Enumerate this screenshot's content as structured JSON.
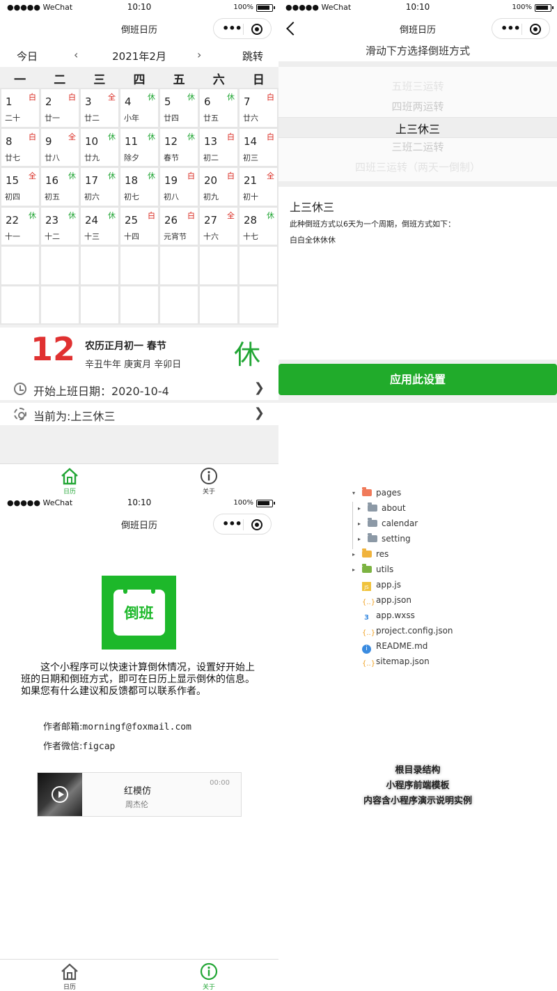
{
  "status_bar": {
    "carrier": "●●●●● WeChat",
    "time": "10:10",
    "battery": "100%"
  },
  "app_title": "倒班日历",
  "calendar": {
    "toolbar": {
      "today": "今日",
      "prev": "‹",
      "month": "2021年2月",
      "next": "›",
      "jump": "跳转"
    },
    "weekdays": [
      "一",
      "二",
      "三",
      "四",
      "五",
      "六",
      "日"
    ],
    "days": [
      {
        "d": "1",
        "lunar": "二十",
        "tag": "白",
        "kind": "work"
      },
      {
        "d": "2",
        "lunar": "廿一",
        "tag": "白",
        "kind": "work"
      },
      {
        "d": "3",
        "lunar": "廿二",
        "tag": "全",
        "kind": "work"
      },
      {
        "d": "4",
        "lunar": "小年",
        "tag": "休",
        "kind": "rest"
      },
      {
        "d": "5",
        "lunar": "廿四",
        "tag": "休",
        "kind": "rest"
      },
      {
        "d": "6",
        "lunar": "廿五",
        "tag": "休",
        "kind": "rest"
      },
      {
        "d": "7",
        "lunar": "廿六",
        "tag": "白",
        "kind": "work"
      },
      {
        "d": "8",
        "lunar": "廿七",
        "tag": "白",
        "kind": "work"
      },
      {
        "d": "9",
        "lunar": "廿八",
        "tag": "全",
        "kind": "work"
      },
      {
        "d": "10",
        "lunar": "廿九",
        "tag": "休",
        "kind": "rest"
      },
      {
        "d": "11",
        "lunar": "除夕",
        "tag": "休",
        "kind": "rest"
      },
      {
        "d": "12",
        "lunar": "春节",
        "tag": "休",
        "kind": "rest"
      },
      {
        "d": "13",
        "lunar": "初二",
        "tag": "白",
        "kind": "work"
      },
      {
        "d": "14",
        "lunar": "初三",
        "tag": "白",
        "kind": "work"
      },
      {
        "d": "15",
        "lunar": "初四",
        "tag": "全",
        "kind": "work"
      },
      {
        "d": "16",
        "lunar": "初五",
        "tag": "休",
        "kind": "rest"
      },
      {
        "d": "17",
        "lunar": "初六",
        "tag": "休",
        "kind": "rest"
      },
      {
        "d": "18",
        "lunar": "初七",
        "tag": "休",
        "kind": "rest"
      },
      {
        "d": "19",
        "lunar": "初八",
        "tag": "白",
        "kind": "work"
      },
      {
        "d": "20",
        "lunar": "初九",
        "tag": "白",
        "kind": "work"
      },
      {
        "d": "21",
        "lunar": "初十",
        "tag": "全",
        "kind": "work"
      },
      {
        "d": "22",
        "lunar": "十一",
        "tag": "休",
        "kind": "rest"
      },
      {
        "d": "23",
        "lunar": "十二",
        "tag": "休",
        "kind": "rest"
      },
      {
        "d": "24",
        "lunar": "十三",
        "tag": "休",
        "kind": "rest"
      },
      {
        "d": "25",
        "lunar": "十四",
        "tag": "白",
        "kind": "work"
      },
      {
        "d": "26",
        "lunar": "元宵节",
        "tag": "白",
        "kind": "work"
      },
      {
        "d": "27",
        "lunar": "十六",
        "tag": "全",
        "kind": "work"
      },
      {
        "d": "28",
        "lunar": "十七",
        "tag": "休",
        "kind": "rest"
      }
    ],
    "empty_cells": 14,
    "detail": {
      "day": "12",
      "lunar_line": "农历正月初一  春节",
      "ganzhi_line": "辛丑牛年  庚寅月  辛卯日",
      "status": "休"
    },
    "start_date_row": "开始上班日期：2020-10-4",
    "mode_row": "当前为:上三休三",
    "chevron": "❯"
  },
  "tabbar": {
    "home_label": "日历",
    "about_label": "关于"
  },
  "picker": {
    "heading": "滑动下方选择倒班方式",
    "options": [
      "五班三运转",
      "四班两运转",
      "上三休三",
      "三班二运转",
      "四班三运转（两天一倒制）"
    ],
    "selected_index": 2,
    "desc_title": "上三休三",
    "desc_line1": "此种倒班方式以6天为一个周期，倒班方式如下：",
    "desc_line2": "白白全休休休",
    "apply_label": "应用此设置"
  },
  "about": {
    "logo_text": "倒班",
    "paragraph": "这个小程序可以快速计算倒休情况，设置好开始上班的日期和倒班方式，即可在日历上显示倒休的信息。如果您有什么建议和反馈都可以联系作者。",
    "email_label": "作者邮箱:",
    "email": "morningf@foxmail.com",
    "wechat_label": "作者微信:",
    "wechat": "figcap",
    "player": {
      "song": "红模仿",
      "artist": "周杰伦",
      "duration": "00:00"
    }
  },
  "file_tree": [
    {
      "name": "pages",
      "type": "folder",
      "color": "#f07a5a",
      "level": 0,
      "arrow": "▾"
    },
    {
      "name": "about",
      "type": "folder",
      "color": "#8c99a6",
      "level": 1,
      "arrow": "▸"
    },
    {
      "name": "calendar",
      "type": "folder",
      "color": "#8c99a6",
      "level": 1,
      "arrow": "▸"
    },
    {
      "name": "setting",
      "type": "folder",
      "color": "#8c99a6",
      "level": 1,
      "arrow": "▸"
    },
    {
      "name": "res",
      "type": "folder",
      "color": "#f0b33c",
      "level": 0,
      "arrow": "▸"
    },
    {
      "name": "utils",
      "type": "folder",
      "color": "#7cb342",
      "level": 0,
      "arrow": "▸"
    },
    {
      "name": "app.js",
      "type": "js",
      "level": 0
    },
    {
      "name": "app.json",
      "type": "json",
      "level": 0
    },
    {
      "name": "app.wxss",
      "type": "css",
      "level": 0
    },
    {
      "name": "project.config.json",
      "type": "json",
      "level": 0
    },
    {
      "name": "README.md",
      "type": "md",
      "level": 0
    },
    {
      "name": "sitemap.json",
      "type": "json",
      "level": 0
    }
  ],
  "captions": [
    "根目录结构",
    "小程序前端模板",
    "内容含小程序演示说明实例"
  ],
  "colors": {
    "accent": "#22a635",
    "work": "#d9281f",
    "button": "#21ab2b"
  }
}
